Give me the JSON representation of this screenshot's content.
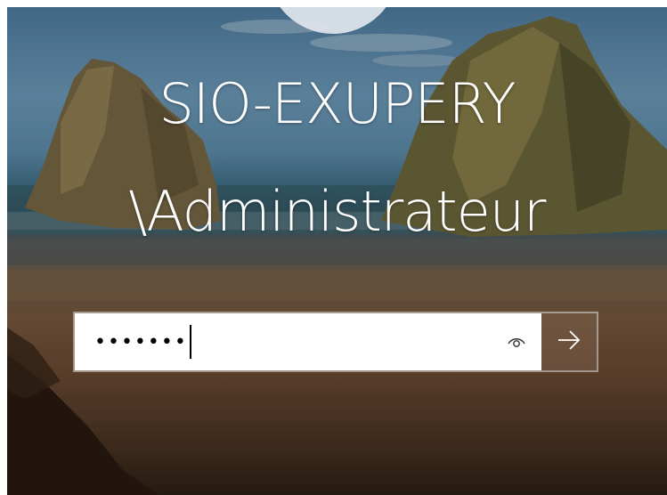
{
  "login": {
    "user_line1": "SIO-EXUPERY",
    "user_line2": "\\Administrateur",
    "password_value": "•••••••",
    "reveal_icon": "eye-icon",
    "submit_icon": "arrow-right-icon"
  },
  "colors": {
    "text": "#ffffff",
    "field_bg": "#ffffff",
    "submit_bg": "#785f4b"
  }
}
